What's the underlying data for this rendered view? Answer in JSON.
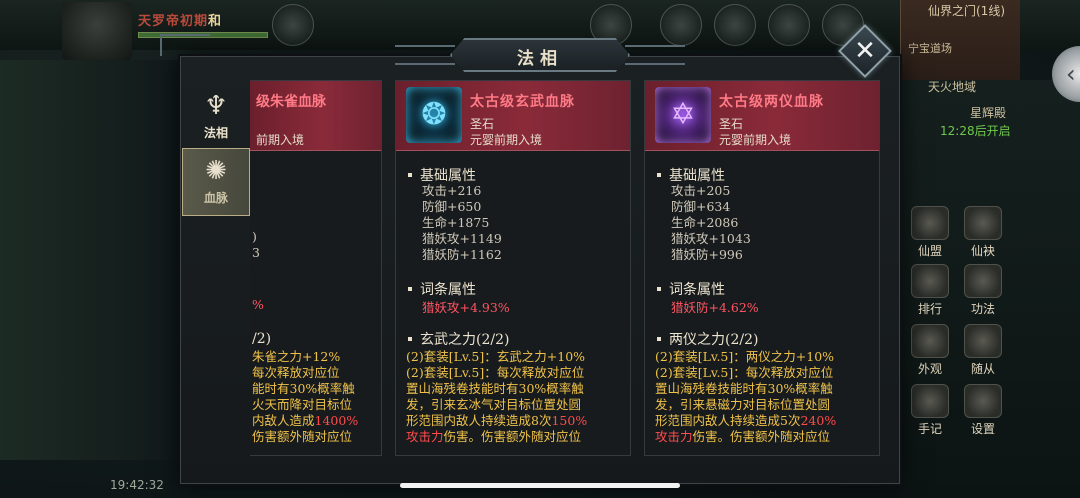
{
  "hud": {
    "player_name_part1": "天罗帝",
    "player_name_part2": "初期",
    "player_name_part3": "和",
    "map_title": "仙界之门(1线)",
    "map_sub": "宁宝道场",
    "map_sub2": "天火地域",
    "right_label": "星辉殿",
    "right_timer": "12:28后开启",
    "menu": [
      "仙盟",
      "仙袂",
      "排行",
      "功法",
      "外观",
      "随从",
      "手记",
      "设置"
    ],
    "clock": "19:42:32"
  },
  "modal": {
    "title": "法相",
    "close_label": "✕"
  },
  "tabs": [
    {
      "label": "法相",
      "icon": "faxiang-icon",
      "glyph": "♆"
    },
    {
      "label": "血脉",
      "icon": "xuemai-icon",
      "glyph": "✺"
    }
  ],
  "partial_card": {
    "name": "级朱雀血脉",
    "requirement": "前期入境",
    "frag1": ")",
    "frag2": "3",
    "frag3": "%",
    "set_title": "/2)",
    "set_lines": [
      "朱雀之力+12%",
      "每次释放对应位",
      "能时有30%概率触",
      "火天而降对目标位",
      "内敌人造成1400%",
      "伤害额外随对应位"
    ]
  },
  "cards": [
    {
      "name": "太古级玄武血脉",
      "type": "圣石",
      "requirement": "元婴前期入境",
      "base_title": "基础属性",
      "stats": [
        "攻击+216",
        "防御+650",
        "生命+1875",
        "猎妖攻+1149",
        "猎妖防+1162"
      ],
      "affix_title": "词条属性",
      "affix": "猎妖攻+4.93%",
      "set_title": "玄武之力(2/2)",
      "set_lines": [
        [
          "(2)套装[Lv.5]：玄武之力+10%"
        ],
        [
          "(2)套装[Lv.5]：每次释放对应位"
        ],
        [
          "置山海残卷技能时有30%概率触"
        ],
        [
          "发，引来玄冰气对目标位置处圆"
        ],
        [
          "形范围内敌人持续造成8次",
          "150%"
        ],
        [
          "攻击力",
          "伤害。伤害额外随对应位"
        ]
      ]
    },
    {
      "name": "太古级两仪血脉",
      "type": "圣石",
      "requirement": "元婴前期入境",
      "base_title": "基础属性",
      "stats": [
        "攻击+205",
        "防御+634",
        "生命+2086",
        "猎妖攻+1043",
        "猎妖防+996"
      ],
      "affix_title": "词条属性",
      "affix": "猎妖防+4.62%",
      "set_title": "两仪之力(2/2)",
      "set_lines": [
        [
          "(2)套装[Lv.5]：两仪之力+10%"
        ],
        [
          "(2)套装[Lv.5]：每次释放对应位"
        ],
        [
          "置山海残卷技能时有30%概率触"
        ],
        [
          "发，引来悬磁力对目标位置处圆"
        ],
        [
          "形范围内敌人持续造成5次",
          "240%"
        ],
        [
          "攻击力",
          "伤害。伤害额外随对应位"
        ]
      ]
    }
  ]
}
